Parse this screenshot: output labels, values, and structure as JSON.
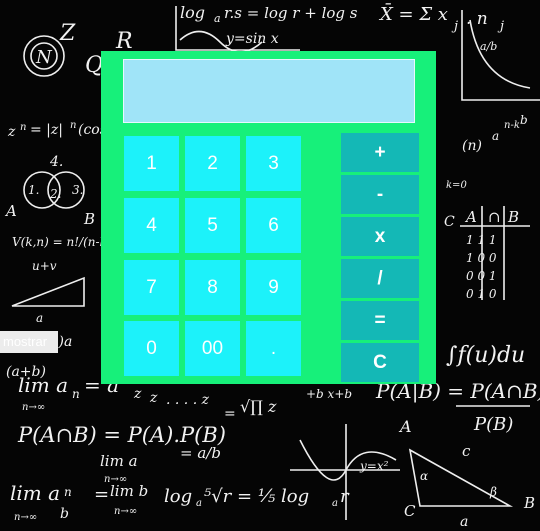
{
  "calculator": {
    "display_value": "",
    "number_keys": [
      "1",
      "2",
      "3",
      "4",
      "5",
      "6",
      "7",
      "8",
      "9",
      "0",
      "00",
      "."
    ],
    "operator_keys": {
      "add": "+",
      "subtract": "-",
      "multiply": "x",
      "divide": "/",
      "equals": "=",
      "clear": "C"
    }
  },
  "mostrar_button": {
    "label": "mostrar"
  },
  "colors": {
    "background": "#050505",
    "calculator_panel": "#17f07a",
    "display": "#a0e4f8",
    "number_key": "#1cf2fa",
    "operator_key": "#14b8b6",
    "key_text": "#ffffff"
  },
  "background_image": "math chalkboard"
}
